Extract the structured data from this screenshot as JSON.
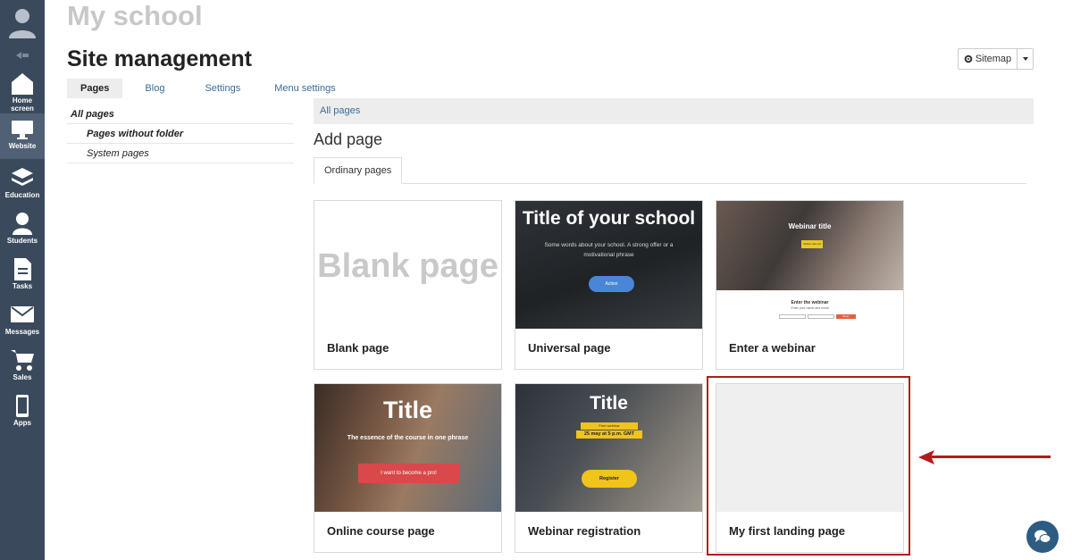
{
  "header": {
    "school": "My school",
    "title": "Site management",
    "sitemap_label": "Sitemap"
  },
  "rail": {
    "home": "Home screen",
    "website": "Website",
    "education": "Education",
    "students": "Students",
    "tasks": "Tasks",
    "messages": "Messages",
    "sales": "Sales",
    "apps": "Apps"
  },
  "tabs": [
    "Pages",
    "Blog",
    "Settings",
    "Menu settings"
  ],
  "folders": [
    "All pages",
    "Pages without folder",
    "System pages"
  ],
  "breadcrumb": "All pages",
  "add_page": "Add page",
  "subtab": "Ordinary pages",
  "cards": [
    {
      "name": "Blank page",
      "thumb": {
        "text": "Blank page"
      }
    },
    {
      "name": "Universal page",
      "thumb": {
        "title": "Title of your school",
        "sub1": "Some words about your school. A strong offer or a",
        "sub2": "motivational phrase",
        "button": "Action"
      }
    },
    {
      "name": "Enter a webinar",
      "thumb": {
        "title": "Webinar title",
        "badge": "Webinar date and time",
        "enter": "Enter the webinar",
        "enter_sub": "Enter your name and email",
        "button": "Enter"
      }
    },
    {
      "name": "Online course page",
      "thumb": {
        "title": "Title",
        "sub": "The essence of the course in one phrase",
        "button": "I want to become a pro!"
      }
    },
    {
      "name": "Webinar registration",
      "thumb": {
        "title": "Title",
        "badge1": "Free webinar",
        "badge2": "25 may at 5 p.m. GMT",
        "button": "Register"
      }
    },
    {
      "name": "My first landing page",
      "thumb": {}
    }
  ],
  "colors": {
    "rail": "#3a4a5c",
    "accent": "#3a6c97",
    "highlight": "#b31b1b"
  }
}
